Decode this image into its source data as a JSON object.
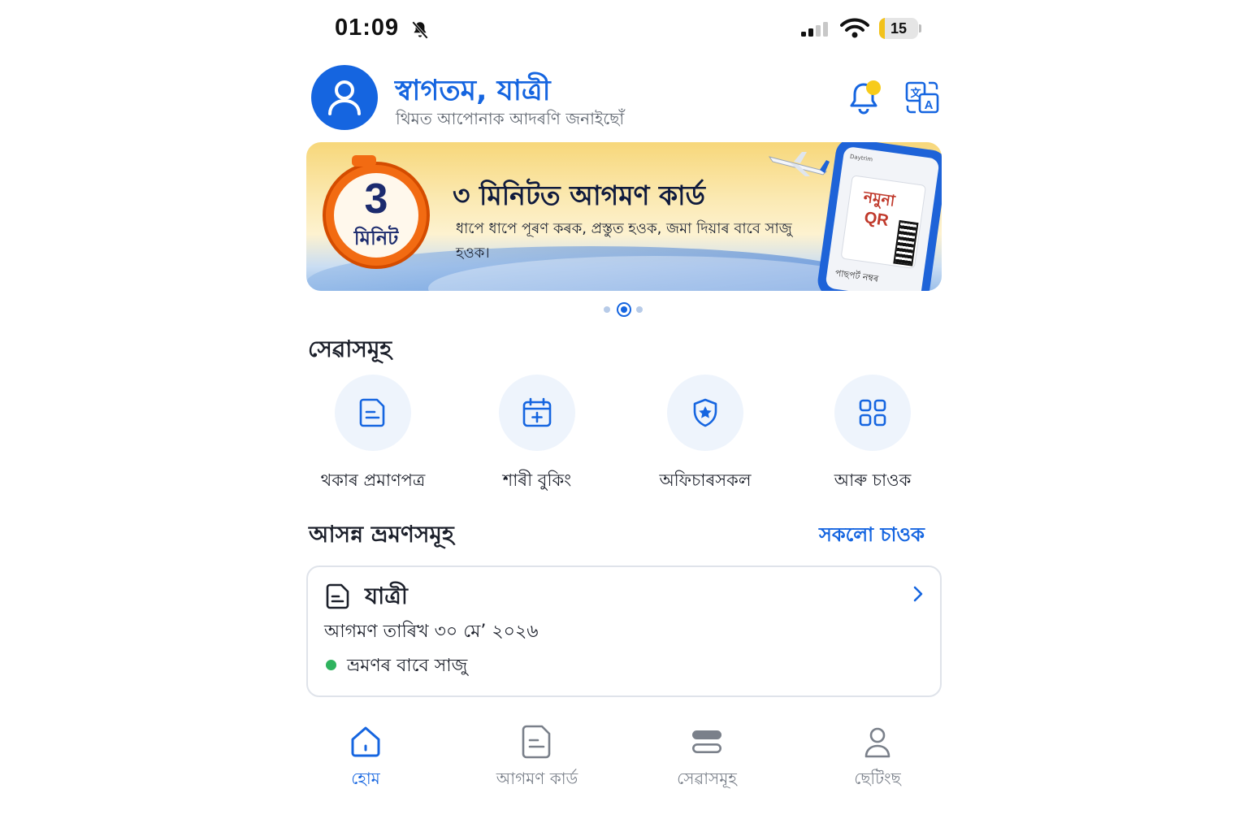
{
  "status_bar": {
    "time": "01:09",
    "battery": "15",
    "battery_level": 0.15,
    "icons": [
      "bell-muted-icon",
      "signal-icon",
      "wifi-icon",
      "battery-icon"
    ]
  },
  "header": {
    "title": "স্বাগতম, যাত্ৰী",
    "subtitle": "থিমত আপোনাক আদৰণি জনাইছোঁ",
    "icons": [
      "user-icon",
      "bell-icon",
      "translate-icon"
    ]
  },
  "banner": {
    "timer_number": "3",
    "timer_unit": "মিনিট",
    "title": "৩ মিনিটত আগমণ কাৰ্ড",
    "description": "ধাপে ধাপে পূৰণ কৰক, প্ৰস্তুত হওক, জমা দিয়াৰ বাবে সাজু হওক।",
    "sample_title": "নমুনা",
    "sample_qr": "QR",
    "phone_label": "পাছপৰ্ট নম্বৰ",
    "phone_brand": "Daytrim",
    "page_count": 3,
    "active_page": 2
  },
  "services": {
    "title": "সেৱাসমূহ",
    "items": [
      {
        "label": "থকাৰ প্ৰমাণপত্ৰ",
        "icon": "document-icon"
      },
      {
        "label": "শাৰী বুকিং",
        "icon": "calendar-add-icon"
      },
      {
        "label": "অফিচাৰসকল",
        "icon": "police-badge-icon"
      },
      {
        "label": "আৰু চাওক",
        "icon": "grid-icon"
      }
    ]
  },
  "trips": {
    "title": "আসন্ন ভ্ৰমণসমূহ",
    "see_all": "সকলো চাওক",
    "card": {
      "name": "যাত্ৰী",
      "date": "আগমণ তাৰিখ ৩০ মে’ ২০২৬",
      "status": "ভ্ৰমণৰ বাবে সাজু",
      "status_color": "#2fb35e"
    }
  },
  "bottom_nav": {
    "items": [
      {
        "label": "হোম",
        "icon": "home-icon",
        "active": true
      },
      {
        "label": "আগমণ কাৰ্ড",
        "icon": "card-document-icon",
        "active": false
      },
      {
        "label": "সেৱাসমূহ",
        "icon": "services-stack-icon",
        "active": false
      },
      {
        "label": "ছেটিংছ",
        "icon": "profile-settings-icon",
        "active": false
      }
    ]
  },
  "colors": {
    "accent": "#1565e0",
    "notification_dot": "#f7cb1a",
    "muted_text": "#7a808a"
  }
}
